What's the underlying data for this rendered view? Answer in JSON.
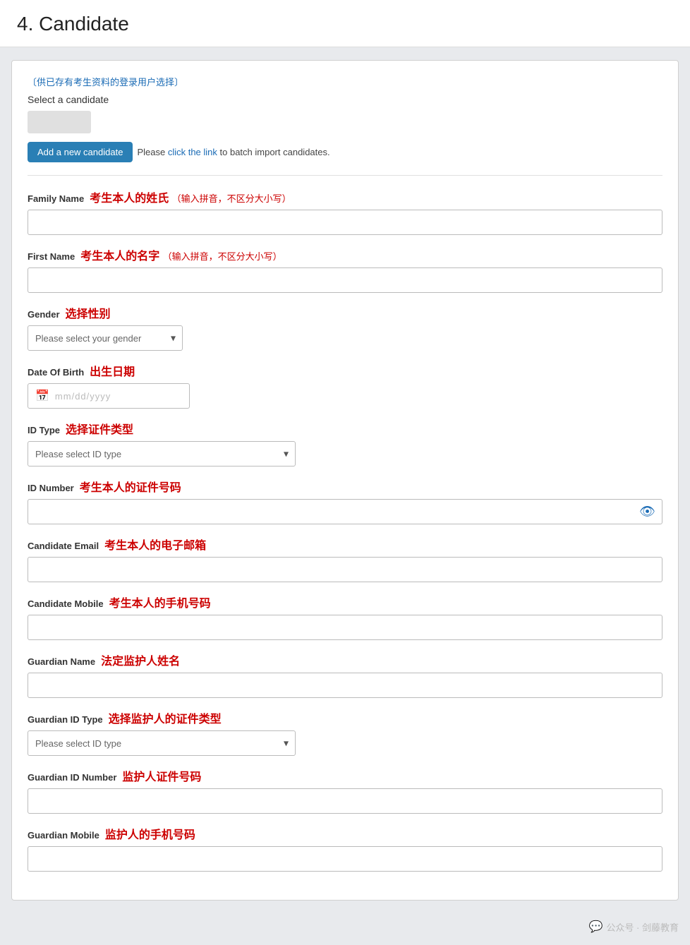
{
  "page": {
    "title": "4.  Candidate"
  },
  "note": {
    "link_text": "〔供已存有考生资料的登录用户选择〕"
  },
  "candidate_section": {
    "select_label": "Select a candidate",
    "add_button": "Add a new candidate",
    "import_text_before": "Please",
    "import_link": "click the link",
    "import_text_after": "to batch import candidates."
  },
  "fields": {
    "family_name": {
      "label_en": "Family Name",
      "label_cn": "考生本人的姓氏",
      "label_cn_sub": "（输入拼音，不区分大小写）",
      "placeholder": ""
    },
    "first_name": {
      "label_en": "First Name",
      "label_cn": "考生本人的名字",
      "label_cn_sub": "（输入拼音，不区分大小写）",
      "placeholder": ""
    },
    "gender": {
      "label_en": "Gender",
      "label_cn": "选择性别",
      "placeholder": "Please select your gender"
    },
    "date_of_birth": {
      "label_en": "Date Of Birth",
      "label_cn": "出生日期",
      "placeholder": "mm/dd/yyyy"
    },
    "id_type": {
      "label_en": "ID Type",
      "label_cn": "选择证件类型",
      "placeholder": "Please select ID type"
    },
    "id_number": {
      "label_en": "ID Number",
      "label_cn": "考生本人的证件号码",
      "placeholder": ""
    },
    "candidate_email": {
      "label_en": "Candidate Email",
      "label_cn": "考生本人的电子邮箱",
      "placeholder": ""
    },
    "candidate_mobile": {
      "label_en": "Candidate Mobile",
      "label_cn": "考生本人的手机号码",
      "placeholder": ""
    },
    "guardian_name": {
      "label_en": "Guardian Name",
      "label_cn": "法定监护人姓名",
      "placeholder": ""
    },
    "guardian_id_type": {
      "label_en": "Guardian ID Type",
      "label_cn": "选择监护人的证件类型",
      "placeholder": "Please select ID type"
    },
    "guardian_id_number": {
      "label_en": "Guardian ID Number",
      "label_cn": "监护人证件号码",
      "placeholder": ""
    },
    "guardian_mobile": {
      "label_en": "Guardian Mobile",
      "label_cn": "监护人的手机号码",
      "placeholder": ""
    }
  },
  "watermark": {
    "text": "公众号 · 剑藤教育"
  }
}
